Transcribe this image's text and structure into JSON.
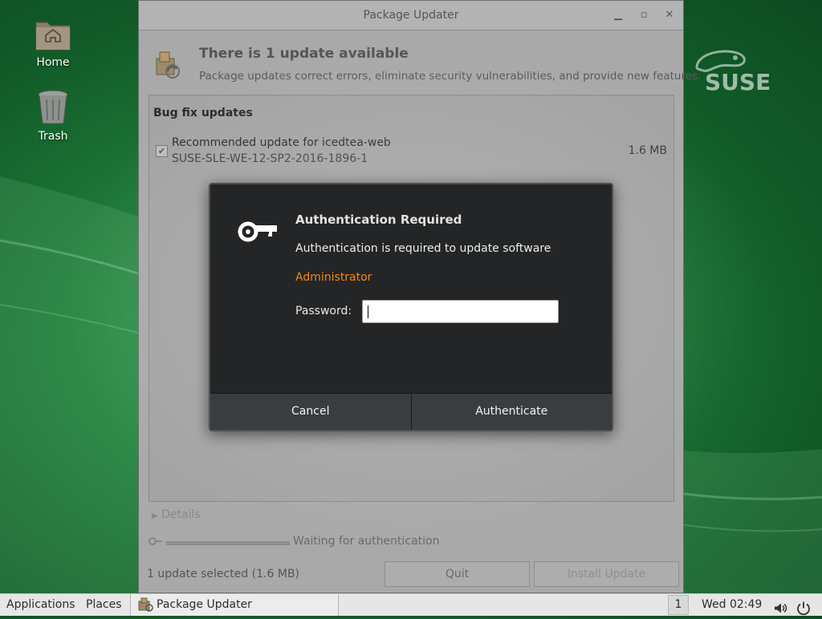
{
  "desktop": {
    "icons": [
      {
        "label": "Home"
      },
      {
        "label": "Trash"
      }
    ],
    "brand_logo_text": "SUSE"
  },
  "window": {
    "title": "Package Updater",
    "header": {
      "title": "There is 1 update available",
      "subtitle": "Package updates correct errors, eliminate security vulnerabilities, and provide new features."
    },
    "section": "Bug fix updates",
    "updates": [
      {
        "name": "Recommended update for icedtea-web",
        "id": "SUSE-SLE-WE-12-SP2-2016-1896-1",
        "size": "1.6 MB",
        "checked": true
      }
    ],
    "details_label": "Details",
    "progress": {
      "text": "Waiting for authentication",
      "fraction": 0
    },
    "selection_summary": "1 update selected (1.6 MB)",
    "buttons": {
      "quit": "Quit",
      "install": "Install Update"
    }
  },
  "auth_dialog": {
    "title": "Authentication Required",
    "message": "Authentication is required to update software",
    "user": "Administrator",
    "password_label": "Password:",
    "password_value": "",
    "buttons": {
      "cancel": "Cancel",
      "authenticate": "Authenticate"
    }
  },
  "panel": {
    "applications": "Applications",
    "places": "Places",
    "task": "Package Updater",
    "workspace": "1",
    "clock": "Wed 02:49"
  },
  "colors": {
    "accent_user": "#f08a16",
    "dialog_bg": "#232526",
    "desktop_green": "#1f7d3a"
  }
}
